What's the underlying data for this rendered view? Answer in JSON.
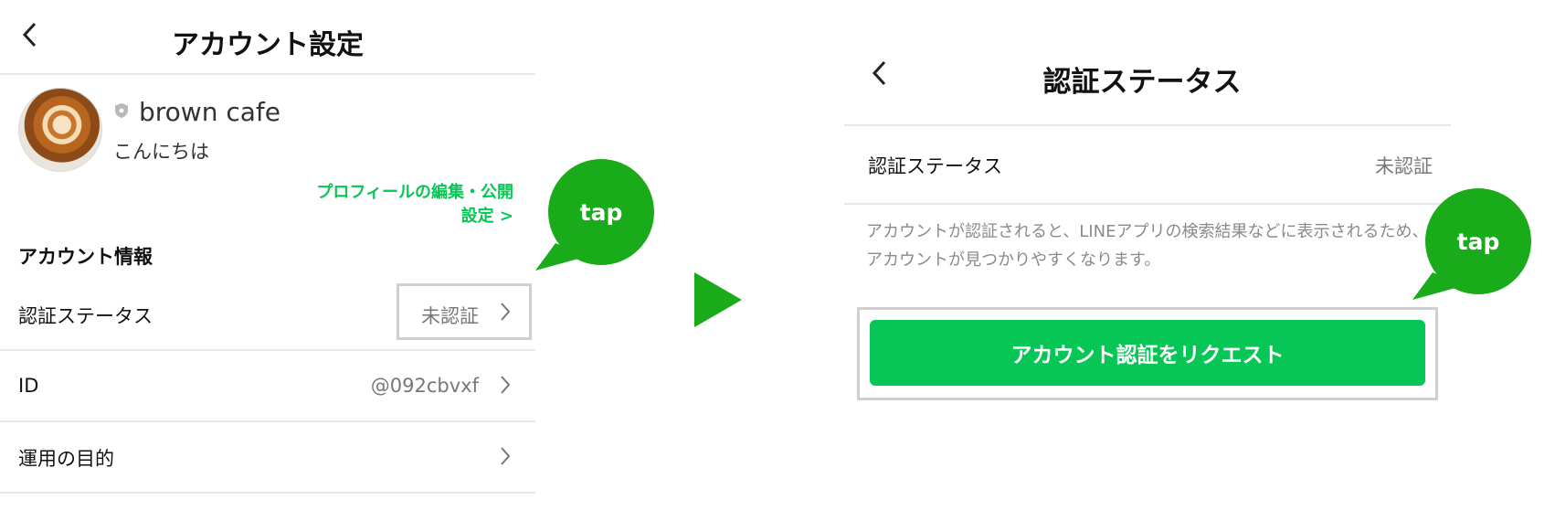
{
  "left_screen": {
    "header": {
      "back_icon": "chevron-left-icon",
      "title": "アカウント設定"
    },
    "profile": {
      "avatar": "latte-art-avatar",
      "badge_icon": "gray-shield-icon",
      "name": "brown cafe",
      "greeting": "こんにちは",
      "edit_link": "プロフィールの編集・公開設定 >"
    },
    "section_title": "アカウント情報",
    "rows": [
      {
        "label": "認証ステータス",
        "value": "未認証",
        "chevron": ">"
      },
      {
        "label": "ID",
        "value": "@092cbvxf",
        "chevron": ">"
      },
      {
        "label": "運用の目的",
        "value": "",
        "chevron": ">"
      }
    ]
  },
  "arrow_icon": "play-triangle-icon",
  "callouts": {
    "left_tap": "tap",
    "right_tap": "tap"
  },
  "right_screen": {
    "header": {
      "back_icon": "chevron-left-icon",
      "title": "認証ステータス"
    },
    "status_row": {
      "label": "認証ステータス",
      "value": "未認証"
    },
    "description": "アカウントが認証されると、LINEアプリの検索結果などに表示されるため、アカウントが見つかりやすくなります。",
    "request_button": "アカウント認証をリクエスト"
  },
  "colors": {
    "accent_green": "#06c755",
    "callout_green": "#1aab1a",
    "highlight_border": "#cfcfcf"
  }
}
